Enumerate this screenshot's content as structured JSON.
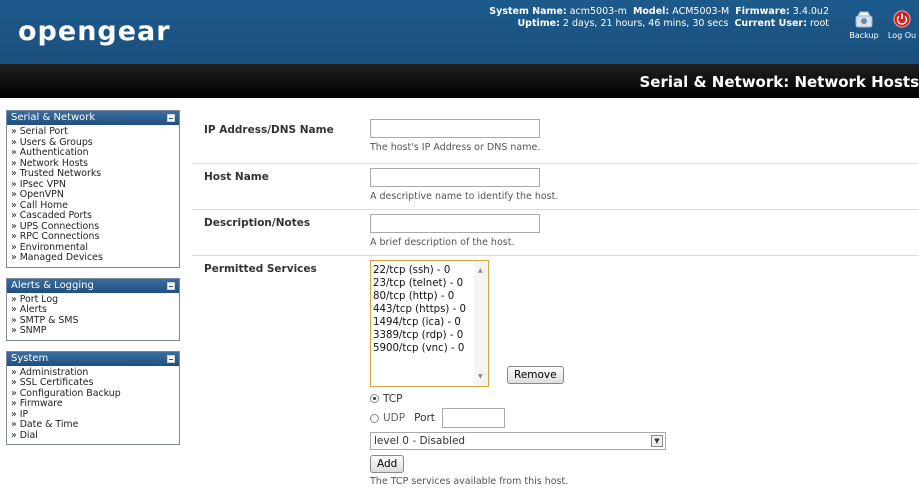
{
  "header": {
    "logo": "opengear",
    "system_name_label": "System Name:",
    "system_name": "acm5003-m",
    "model_label": "Model:",
    "model": "ACM5003-M",
    "firmware_label": "Firmware:",
    "firmware": "3.4.0u2",
    "uptime_label": "Uptime:",
    "uptime": "2 days, 21 hours, 46 mins, 30 secs",
    "user_label": "Current User:",
    "user": "root",
    "backup_label": "Backup",
    "logout_label": "Log Ou"
  },
  "page_title": "Serial & Network: Network Hosts",
  "sidebar": {
    "panels": [
      {
        "title": "Serial & Network",
        "items": [
          "» Serial Port",
          "» Users & Groups",
          "» Authentication",
          "» Network Hosts",
          "» Trusted Networks",
          "» IPsec VPN",
          "» OpenVPN",
          "» Call Home",
          "» Cascaded Ports",
          "» UPS Connections",
          "» RPC Connections",
          "» Environmental",
          "» Managed Devices"
        ]
      },
      {
        "title": "Alerts & Logging",
        "items": [
          "» Port Log",
          "» Alerts",
          "» SMTP & SMS",
          "» SNMP"
        ]
      },
      {
        "title": "System",
        "items": [
          "» Administration",
          "» SSL Certificates",
          "» Configuration Backup",
          "» Firmware",
          "» IP",
          "» Date & Time",
          "» Dial"
        ]
      }
    ]
  },
  "form": {
    "ip": {
      "label": "IP Address/DNS Name",
      "value": "",
      "help": "The host's IP Address or DNS name."
    },
    "hostname": {
      "label": "Host Name",
      "value": "",
      "help": "A descriptive name to identify the host."
    },
    "description": {
      "label": "Description/Notes",
      "value": "",
      "help": "A brief description of the host."
    },
    "services": {
      "label": "Permitted Services",
      "list": [
        "22/tcp (ssh) - 0",
        "23/tcp (telnet) - 0",
        "80/tcp (http) - 0",
        "443/tcp (https) - 0",
        "1494/tcp (ica) - 0",
        "3389/tcp (rdp) - 0",
        "5900/tcp (vnc) - 0"
      ],
      "remove_label": "Remove",
      "tcp_label": "TCP",
      "udp_label": "UDP",
      "port_label": "Port",
      "port_value": "",
      "level_selected": "level 0 - Disabled",
      "add_label": "Add",
      "help": "The TCP services available from this host."
    }
  },
  "colors": {
    "header_blue": "#1d5b8c",
    "title_bar": "#000000",
    "listbox_border": "#d4a640"
  }
}
